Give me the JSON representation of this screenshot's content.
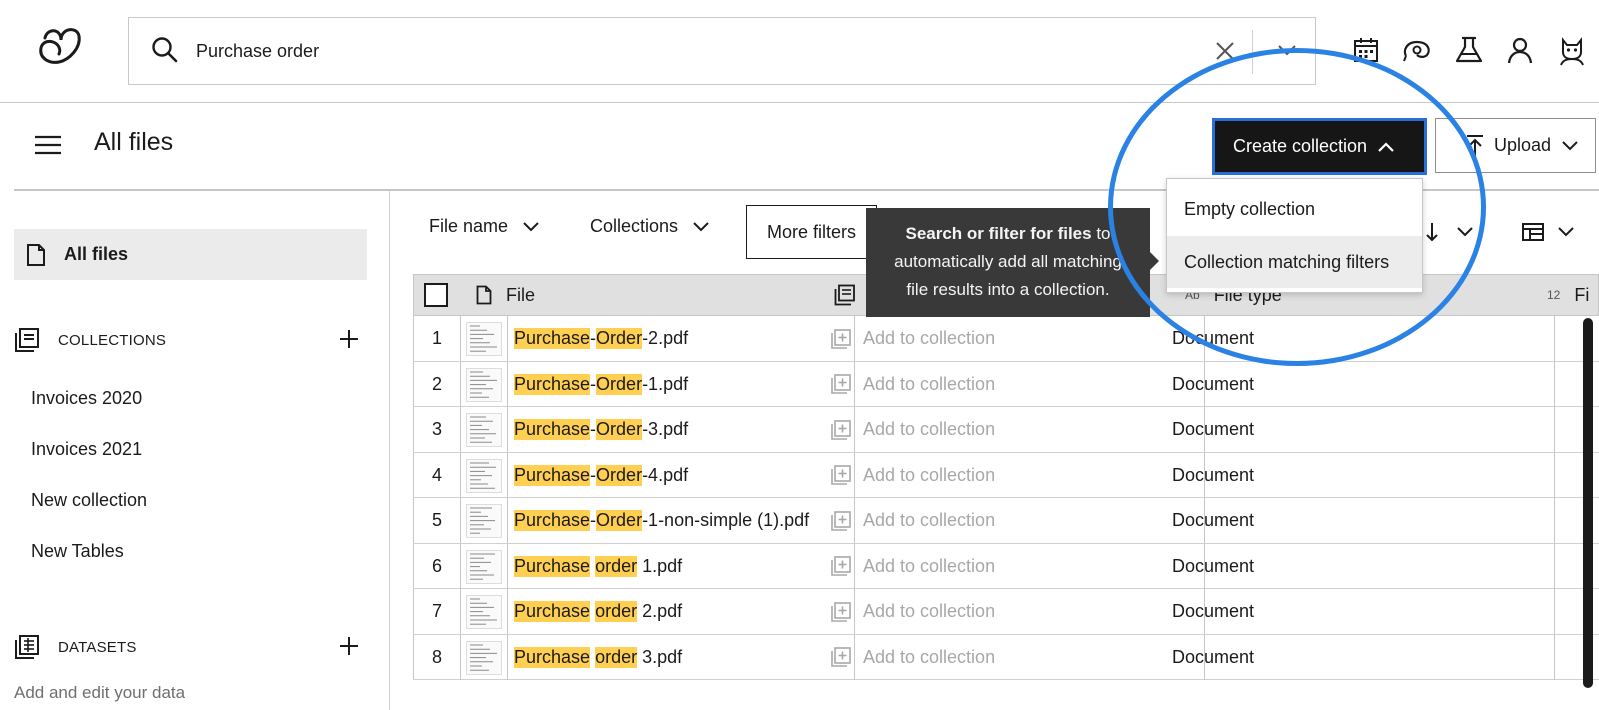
{
  "search": {
    "value": "Purchase order",
    "placeholder": ""
  },
  "topbar_icons": [
    "calendar-icon",
    "support-icon",
    "labs-flask-icon",
    "user-icon",
    "avatar-icon"
  ],
  "header": {
    "title": "All files",
    "create_collection_label": "Create collection",
    "upload_label": "Upload"
  },
  "create_menu": {
    "items": [
      "Empty collection",
      "Collection matching filters"
    ]
  },
  "sidebar": {
    "all_files_label": "All files",
    "collections_heading": "COLLECTIONS",
    "collections": [
      "Invoices 2020",
      "Invoices 2021",
      "New collection",
      "New Tables"
    ],
    "datasets_heading": "DATASETS",
    "datasets_hint": "Add and edit your data"
  },
  "filters": {
    "file_name": "File name",
    "collections": "Collections",
    "more_filters": "More filters"
  },
  "tooltip": {
    "bold": "Search or filter for files",
    "rest_line1": " to",
    "line2": "automatically add all matching",
    "line3": "file results into a collection."
  },
  "table": {
    "columns": {
      "file": "File",
      "file_type_tag": "Ab",
      "file_type": "File type",
      "num_tag": "12",
      "next_col": "Fi"
    },
    "add_to_collection_label": "Add to collection",
    "rows": [
      {
        "index": "1",
        "parts": [
          "Purchase",
          "-",
          "Order",
          "-2.pdf"
        ],
        "type": "Document"
      },
      {
        "index": "2",
        "parts": [
          "Purchase",
          "-",
          "Order",
          "-1.pdf"
        ],
        "type": "Document"
      },
      {
        "index": "3",
        "parts": [
          "Purchase",
          "-",
          "Order",
          "-3.pdf"
        ],
        "type": "Document"
      },
      {
        "index": "4",
        "parts": [
          "Purchase",
          "-",
          "Order",
          "-4.pdf"
        ],
        "type": "Document"
      },
      {
        "index": "5",
        "parts": [
          "Purchase",
          "-",
          "Order",
          "-1-non-simple (1).pdf"
        ],
        "type": "Document"
      },
      {
        "index": "6",
        "parts": [
          "Purchase",
          " ",
          "order",
          " 1.pdf"
        ],
        "type": "Document"
      },
      {
        "index": "7",
        "parts": [
          "Purchase",
          " ",
          "order",
          " 2.pdf"
        ],
        "type": "Document"
      },
      {
        "index": "8",
        "parts": [
          "Purchase",
          " ",
          "order",
          " 3.pdf"
        ],
        "type": "Document"
      }
    ]
  },
  "colors": {
    "highlight": "#ffcf52",
    "annotation": "#2a82e4",
    "primary_button": "#161616"
  }
}
